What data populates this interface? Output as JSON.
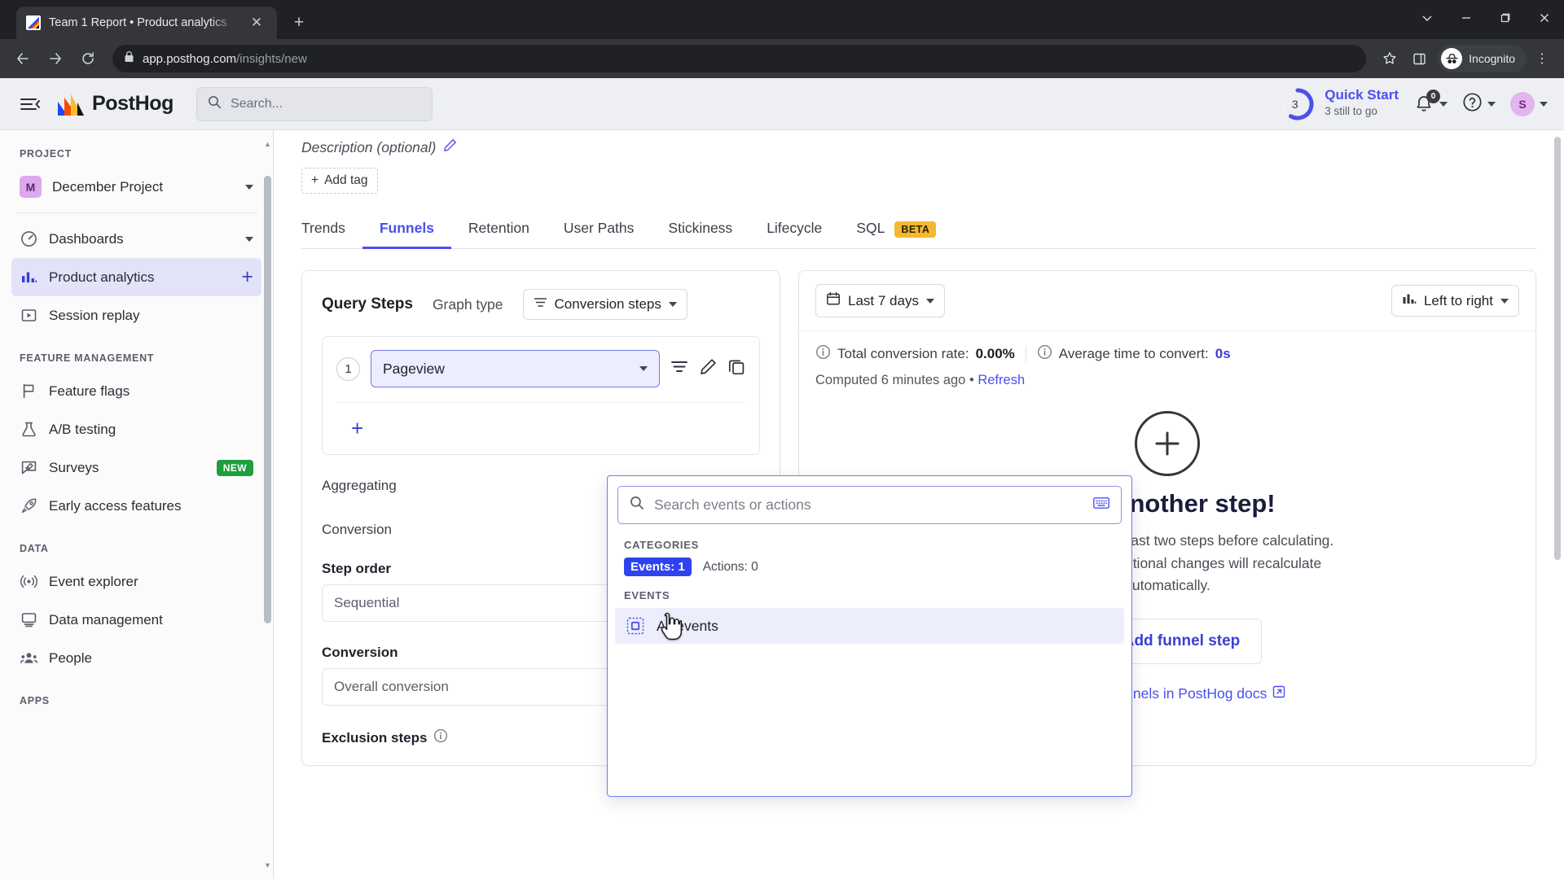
{
  "browser": {
    "tab": {
      "title": "Team 1 Report • Product analytics",
      "favicon": "posthog-favicon",
      "close_label": "✕"
    },
    "new_tab_label": "+",
    "window_controls": {
      "collapse": "⌄",
      "minimize": "—",
      "maximize": "❐",
      "close": "✕"
    },
    "nav": {
      "back": "←",
      "forward": "→",
      "reload": "⟳"
    },
    "url": {
      "lock": "lock-icon",
      "domain": "app.posthog.com",
      "path": "/insights/new"
    },
    "omni_right": {
      "bookmark": "☆",
      "sidepanel": "▯",
      "profile_label": "Incognito",
      "menu": "⋮"
    }
  },
  "topbar": {
    "menu_toggle": "hamburger-icon",
    "brand": "PostHog",
    "search_placeholder": "Search...",
    "quick_start": {
      "count": "3",
      "title": "Quick Start",
      "subtitle": "3 still to go"
    },
    "notifications_badge": "0",
    "help": "?",
    "avatar_initial": "S"
  },
  "sidebar": {
    "sections": [
      {
        "label": "PROJECT",
        "items": [
          {
            "label": "December Project",
            "icon": "project-badge",
            "badge": "M",
            "trailing": "chevron-down-icon",
            "active": false
          }
        ]
      },
      {
        "label": "",
        "items": [
          {
            "label": "Dashboards",
            "icon": "dashboard-icon",
            "trailing": "chevron-down-icon",
            "active": false
          },
          {
            "label": "Product analytics",
            "icon": "bar-chart-icon",
            "trailing": "plus-icon",
            "active": true
          },
          {
            "label": "Session replay",
            "icon": "play-icon",
            "trailing": "",
            "active": false
          }
        ]
      },
      {
        "label": "FEATURE MANAGEMENT",
        "items": [
          {
            "label": "Feature flags",
            "icon": "flag-icon",
            "trailing": "",
            "active": false
          },
          {
            "label": "A/B testing",
            "icon": "flask-icon",
            "trailing": "",
            "active": false
          },
          {
            "label": "Surveys",
            "icon": "survey-icon",
            "trailing": "NEW",
            "active": false
          },
          {
            "label": "Early access features",
            "icon": "rocket-icon",
            "trailing": "",
            "active": false
          }
        ]
      },
      {
        "label": "DATA",
        "items": [
          {
            "label": "Event explorer",
            "icon": "signal-icon",
            "trailing": "",
            "active": false
          },
          {
            "label": "Data management",
            "icon": "monitor-icon",
            "trailing": "",
            "active": false
          },
          {
            "label": "People",
            "icon": "people-icon",
            "trailing": "",
            "active": false
          }
        ]
      },
      {
        "label": "APPS",
        "items": []
      }
    ]
  },
  "main": {
    "description_placeholder": "Description (optional)",
    "add_tag_label": "Add tag",
    "tabs": [
      {
        "label": "Trends",
        "selected": false
      },
      {
        "label": "Funnels",
        "selected": true
      },
      {
        "label": "Retention",
        "selected": false
      },
      {
        "label": "User Paths",
        "selected": false
      },
      {
        "label": "Stickiness",
        "selected": false
      },
      {
        "label": "Lifecycle",
        "selected": false
      },
      {
        "label": "SQL",
        "selected": false,
        "badge": "BETA"
      }
    ],
    "query_panel": {
      "title": "Query Steps",
      "graph_type_label": "Graph type",
      "graph_type_value": "Conversion steps",
      "step_number": "1",
      "step_value": "Pageview",
      "add_step_plus": "+",
      "aggregating_label": "Aggregating",
      "conversion_window_label": "Conversion",
      "step_order_label": "Step order",
      "step_order_value": "Sequential",
      "conversion_rate_label": "Conversion",
      "conversion_rate_value": "Overall conversion",
      "exclusion_steps_label": "Exclusion steps"
    },
    "results_panel": {
      "date_range": "Last 7 days",
      "layout": "Left to right",
      "total_conversion_label": "Total conversion rate:",
      "total_conversion_value": "0.00%",
      "avg_time_label": "Average time to convert:",
      "avg_time_value": "0s",
      "computed_text": "Computed 6 minutes ago",
      "computed_separator": "•",
      "refresh_label": "Refresh",
      "empty_title": "Add another step!",
      "empty_desc_line1": "Funnels require at least two steps before calculating.",
      "empty_desc_line2": "steps defined, additional changes will recalculate",
      "empty_desc_line3": "automatically.",
      "add_funnel_step_label": "Add funnel step",
      "docs_link": "ore about funnels in PostHog docs"
    }
  },
  "popover": {
    "search_placeholder": "Search events or actions",
    "categories_label": "CATEGORIES",
    "category_events": "Events: 1",
    "category_actions": "Actions: 0",
    "events_label": "EVENTS",
    "rows": [
      {
        "label": "All events",
        "icon": "all-events-icon"
      }
    ]
  }
}
